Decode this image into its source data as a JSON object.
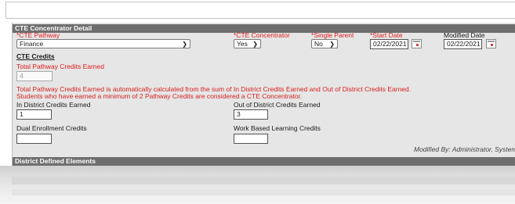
{
  "section": {
    "title": "CTE Concentrator Detail",
    "next_title": "District Defined Elements"
  },
  "fields": {
    "pathway": {
      "label": "*CTE Pathway",
      "value": "Finance"
    },
    "concentrator": {
      "label": "*CTE Concentrator",
      "value": "Yes"
    },
    "single_parent": {
      "label": "*Single Parent",
      "value": "No"
    },
    "start_date": {
      "label": "*Start Date",
      "value": "02/22/2021"
    },
    "modified_date": {
      "label": "Modified Date",
      "value": "02/22/2021"
    }
  },
  "credits": {
    "heading": "CTE Credits",
    "total_label": "Total Pathway Credits Earned",
    "total_value": "4",
    "note_line1": "Total Pathway Credits Earned is automatically calculated from the sum of In District Credits Earned and Out of District Credits Earned.",
    "note_line2": "Students who have earned a minimum of 2 Pathway Credits are considered a CTE Concentrator.",
    "in_district_label": "In District Credits Earned",
    "in_district_value": "1",
    "out_district_label": "Out of District Credits Earned",
    "out_district_value": "3",
    "dual_label": "Dual Enrollment Credits",
    "dual_value": "",
    "work_label": "Work Based Learning Credits",
    "work_value": ""
  },
  "modified_by": "Modified By: Administrator, System",
  "icons": {
    "dropdown": "chevron-down-icon",
    "calendar": "calendar-icon"
  }
}
